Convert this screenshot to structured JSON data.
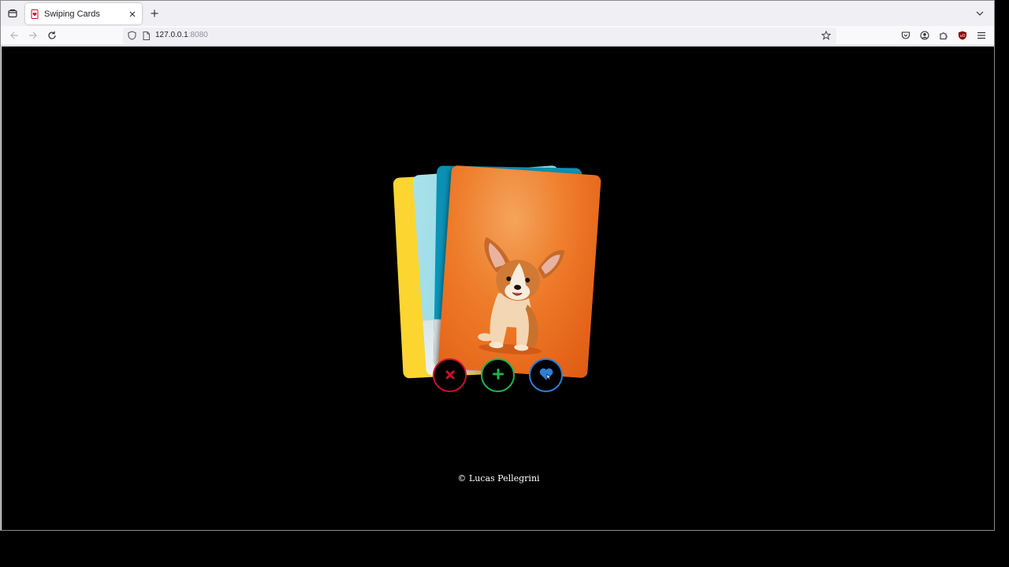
{
  "browser": {
    "tab": {
      "title": "Swiping Cards",
      "favicon": "heart-card-favicon"
    },
    "url": {
      "host": "127.0.0.1",
      "port": ":8080"
    },
    "icons": {
      "tab_list": "tab-list-icon",
      "close_tab": "close-icon",
      "new_tab": "plus-icon",
      "tab_overflow": "chevron-down-icon",
      "back": "back-arrow-icon",
      "forward": "forward-arrow-icon",
      "reload": "reload-icon",
      "shield": "shield-icon",
      "page": "page-icon",
      "bookmark": "star-icon",
      "pocket": "pocket-icon",
      "account": "account-icon",
      "extensions": "puzzle-icon",
      "ublock": "ublock-icon",
      "menu": "hamburger-menu-icon"
    }
  },
  "app": {
    "cards": [
      {
        "name": "yellow-card",
        "color": "#fdd531"
      },
      {
        "name": "cyan-card",
        "color": "#9bdbe6"
      },
      {
        "name": "teal-card",
        "color": "#0c97bb"
      },
      {
        "name": "orange-corgi-card",
        "color": "#ef7e2a",
        "subject": "corgi-puppy-photo"
      }
    ],
    "actions": {
      "dislike": {
        "icon": "x-icon",
        "color": "#c8102e"
      },
      "add": {
        "icon": "plus-icon",
        "color": "#22b14c"
      },
      "like": {
        "icon": "heart-icon",
        "color": "#2b7fd6"
      }
    },
    "footer": "© Lucas Pellegrini"
  }
}
